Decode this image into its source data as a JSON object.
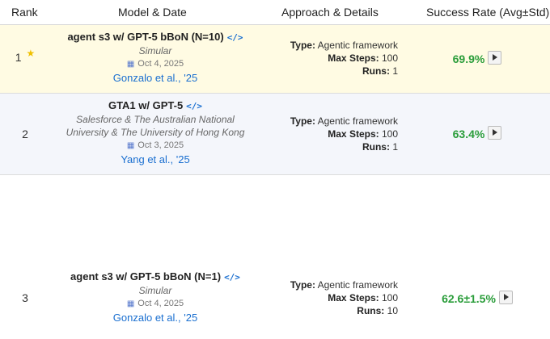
{
  "headers": {
    "rank": "Rank",
    "model": "Model & Date",
    "approach": "Approach & Details",
    "rate": "Success Rate (Avg±Std)"
  },
  "labels": {
    "type": "Type:",
    "max_steps": "Max Steps:",
    "runs": "Runs:"
  },
  "code_icon": "</>",
  "calendar_icon": "▦",
  "star_icon": "★",
  "colors": {
    "first_row_bg": "#fffbe3",
    "second_row_bg": "#f4f6fb",
    "success_green": "#2a9d3a",
    "link_blue": "#1a6fd0",
    "star_yellow": "#f0c000"
  },
  "rows": [
    {
      "rank": "1",
      "model": "agent s3 w/ GPT-5 bBoN (N=10)",
      "org_line1": "Simular",
      "org_line2": "",
      "date": "Oct 4, 2025",
      "citation": "Gonzalo et al., '25",
      "type": "Agentic framework",
      "max_steps": "100",
      "runs": "1",
      "rate": "69.9%"
    },
    {
      "rank": "2",
      "model": "GTA1 w/ GPT-5",
      "org_line1": "Salesforce & The Australian National",
      "org_line2": "University & The University of Hong Kong",
      "date": "Oct 3, 2025",
      "citation": "Yang et al., '25",
      "type": "Agentic framework",
      "max_steps": "100",
      "runs": "1",
      "rate": "63.4%"
    },
    {
      "rank": "3",
      "model": "agent s3 w/ GPT-5 bBoN (N=1)",
      "org_line1": "Simular",
      "org_line2": "",
      "date": "Oct 4, 2025",
      "citation": "Gonzalo et al., '25",
      "type": "Agentic framework",
      "max_steps": "100",
      "runs": "10",
      "rate": "62.6±1.5%"
    }
  ]
}
